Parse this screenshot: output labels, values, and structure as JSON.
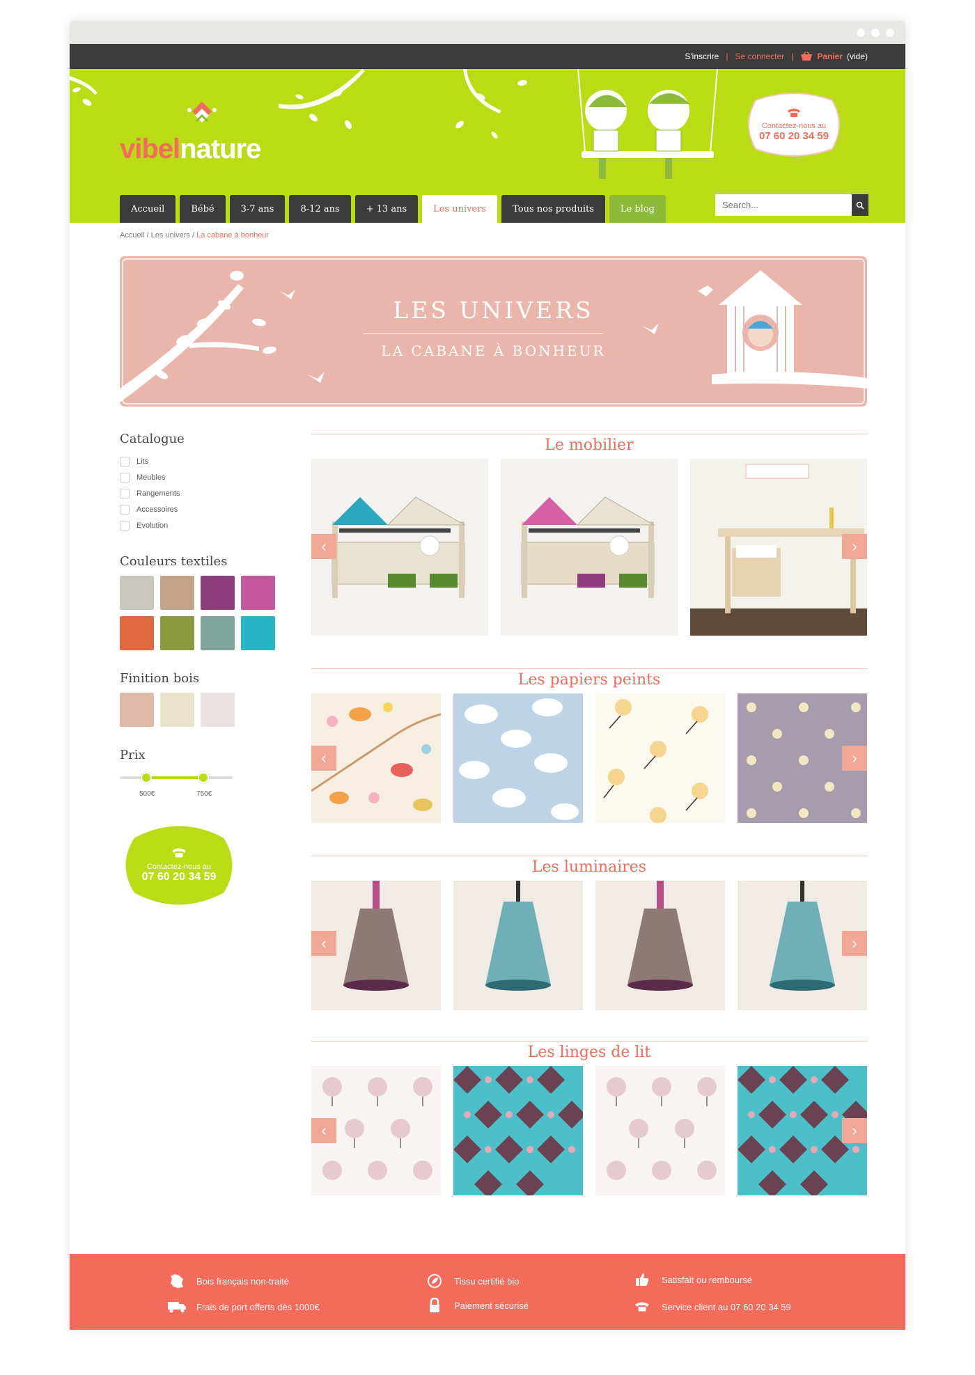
{
  "topbar": {
    "signup": "S'inscrire",
    "sep1": "|",
    "login": "Se connecter",
    "sep2": "|",
    "cart_label": "Panier",
    "cart_state": "(vide)"
  },
  "brand": {
    "part1": "vibel",
    "part2": "nature"
  },
  "header_contact": {
    "label": "Contactez-nous au",
    "phone": "07 60 20 34 59"
  },
  "nav": {
    "tabs": [
      "Accueil",
      "Bébé",
      "3-7 ans",
      "8-12 ans",
      "+ 13 ans",
      "Les univers",
      "Tous nos produits",
      "Le blog"
    ],
    "active": "Les univers"
  },
  "search": {
    "placeholder": "Search..."
  },
  "breadcrumb": {
    "home": "Accueil",
    "sep1": "/",
    "univers": "Les univers",
    "sep2": "/",
    "current": "La cabane à bonheur"
  },
  "hero": {
    "title": "LES UNIVERS",
    "subtitle": "LA CABANE À BONHEUR"
  },
  "sidebar": {
    "catalogue_title": "Catalogue",
    "catalogue_items": [
      "Lits",
      "Meubles",
      "Rangements",
      "Accessoires",
      "Evolution"
    ],
    "textile_title": "Couleurs textiles",
    "textile_colors": [
      "#c9c7c0",
      "#c3a48a",
      "#8e3e7d",
      "#c3589c",
      "#e06a3d",
      "#8a9a3c",
      "#7fa59c",
      "#29b6c4"
    ],
    "wood_title": "Finition bois",
    "wood_colors": [
      "#dfb8a8",
      "#e8e2c8",
      "#e9e3e3"
    ],
    "price_title": "Prix",
    "price_min_label": "500€",
    "price_max_label": "750€",
    "contact_label": "Contactez-nous au",
    "contact_phone": "07 60 20 34 59"
  },
  "sections": [
    {
      "title": "Le mobilier"
    },
    {
      "title": "Les papiers peints"
    },
    {
      "title": "Les luminaires"
    },
    {
      "title": "Les linges de lit"
    }
  ],
  "footer": {
    "items": [
      "Bois français non-traité",
      "Tissu certifié bio",
      "Satisfait ou remboursé",
      "Frais de port offerts dès 1000€",
      "Paiement sécurisé",
      "Service client au 07 60 20 34 59"
    ]
  },
  "colors": {
    "green": "#b9dc14",
    "coral": "#f26b5b",
    "pink": "#eab5ab",
    "dark": "#3b3b3b"
  }
}
